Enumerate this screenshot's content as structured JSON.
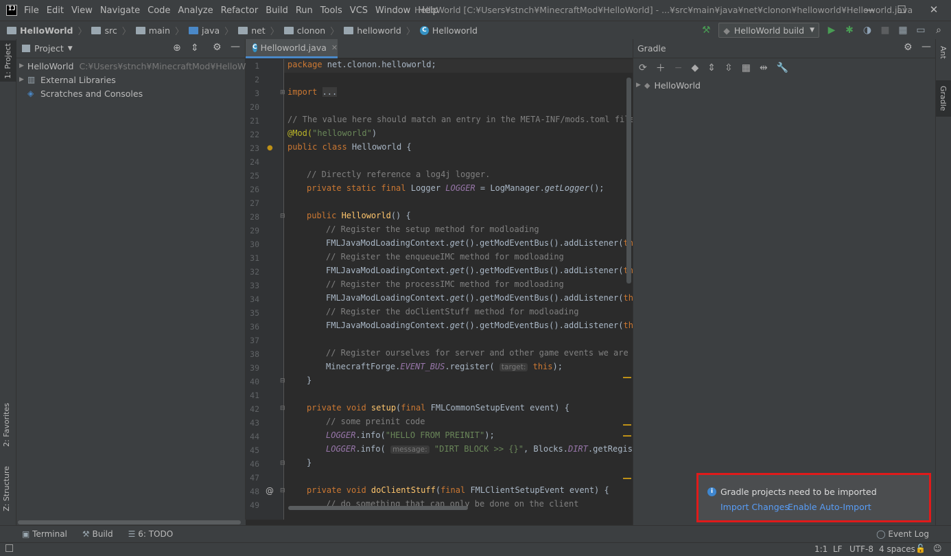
{
  "menu": {
    "logo": "IJ",
    "items": [
      "File",
      "Edit",
      "View",
      "Navigate",
      "Code",
      "Analyze",
      "Refactor",
      "Build",
      "Run",
      "Tools",
      "VCS",
      "Window",
      "Help"
    ],
    "window_title": "HelloWorld [C:¥Users¥stnch¥MinecraftMod¥HelloWorld] - ...¥src¥main¥java¥net¥clonon¥helloworld¥Helloworld.java",
    "minimize": "—",
    "maximize": "☐",
    "close": "✕"
  },
  "breadcrumbs": [
    "HelloWorld",
    "src",
    "main",
    "java",
    "net",
    "clonon",
    "helloworld",
    "Helloworld"
  ],
  "toolbar": {
    "run_config": "HelloWorld build"
  },
  "left_tabs": {
    "project": "1: Project",
    "favorites": "2: Favorites",
    "structure": "Z: Structure"
  },
  "project_panel": {
    "title": "Project",
    "tree": [
      {
        "label": "HelloWorld",
        "path": "C:¥Users¥stnch¥MinecraftMod¥HelloWorld"
      },
      {
        "label": "External Libraries"
      },
      {
        "label": "Scratches and Consoles"
      }
    ]
  },
  "editor": {
    "tab": "Helloworld.java",
    "lines": [
      {
        "n": "1"
      },
      {
        "n": "2"
      },
      {
        "n": "3"
      },
      {
        "n": "20"
      },
      {
        "n": "21"
      },
      {
        "n": "22"
      },
      {
        "n": "23"
      },
      {
        "n": "24"
      },
      {
        "n": "25"
      },
      {
        "n": "26"
      },
      {
        "n": "27"
      },
      {
        "n": "28"
      },
      {
        "n": "29"
      },
      {
        "n": "30"
      },
      {
        "n": "31"
      },
      {
        "n": "32"
      },
      {
        "n": "33"
      },
      {
        "n": "34"
      },
      {
        "n": "35"
      },
      {
        "n": "36"
      },
      {
        "n": "37"
      },
      {
        "n": "38"
      },
      {
        "n": "39"
      },
      {
        "n": "40"
      },
      {
        "n": "41"
      },
      {
        "n": "42"
      },
      {
        "n": "43"
      },
      {
        "n": "44"
      },
      {
        "n": "45"
      },
      {
        "n": "46"
      },
      {
        "n": "47"
      },
      {
        "n": "48"
      },
      {
        "n": "49"
      }
    ],
    "code": {
      "l1a": "package ",
      "l1b": "net.clonon.helloworld;",
      "l3a": "import ",
      "l3b": "...",
      "l21": "// The value here should match an entry in the META-INF/mods.toml file",
      "l22a": "@Mod(",
      "l22b": "\"helloworld\"",
      "l22c": ")",
      "l23a": "public class ",
      "l23b": "Helloworld {",
      "l25": "// Directly reference a log4j logger.",
      "l26a": "private static final ",
      "l26b": "Logger ",
      "l26c": "LOGGER",
      "l26d": " = LogManager.",
      "l26e": "getLogger",
      "l26f": "();",
      "l28a": "public ",
      "l28b": "Helloworld",
      "l28c": "() {",
      "l29": "// Register the setup method for modloading",
      "l30a": "FMLJavaModLoadingContext.",
      "l30b": "get",
      "l30c": "().getModEventBus().addListener(",
      "l30d": "this",
      "l31": "// Register the enqueueIMC method for modloading",
      "l33": "// Register the processIMC method for modloading",
      "l35": "// Register the doClientStuff method for modloading",
      "l38": "// Register ourselves for server and other game events we are in",
      "l39a": "MinecraftForge.",
      "l39b": "EVENT_BUS",
      "l39c": ".register( ",
      "l39d": "target:",
      "l39e": "this",
      "l39f": ");",
      "l40": "}",
      "l42a": "private void ",
      "l42b": "setup",
      "l42c": "(",
      "l42d": "final ",
      "l42e": "FMLCommonSetupEvent event) {",
      "l43": "// some preinit code",
      "l44a": "LOGGER",
      "l44b": ".info(",
      "l44c": "\"HELLO FROM PREINIT\"",
      "l44d": ");",
      "l45a": "LOGGER",
      "l45b": ".info( ",
      "l45c": "message:",
      "l45d": " \"DIRT BLOCK >> {}\"",
      "l45e": ", Blocks.",
      "l45f": "DIRT",
      "l45g": ".getRegistry",
      "l46": "}",
      "l48a": "private void ",
      "l48b": "doClientStuff",
      "l48c": "(",
      "l48d": "final ",
      "l48e": "FMLClientSetupEvent event) {",
      "l49": "// do something that can only be done on the client"
    }
  },
  "gradle_panel": {
    "title": "Gradle",
    "tree": [
      "HelloWorld"
    ]
  },
  "right_tabs": {
    "ant": "Ant",
    "gradle": "Gradle"
  },
  "bottom_tabs": {
    "terminal": "Terminal",
    "build": "Build",
    "todo": "6: TODO",
    "event_log": "Event Log"
  },
  "status": {
    "position": "1:1",
    "line_sep": "LF",
    "encoding": "UTF-8",
    "indent": "4 spaces"
  },
  "notification": {
    "title": "Gradle projects need to be imported",
    "link1": "Import Changes",
    "link2": "Enable Auto-Import"
  }
}
